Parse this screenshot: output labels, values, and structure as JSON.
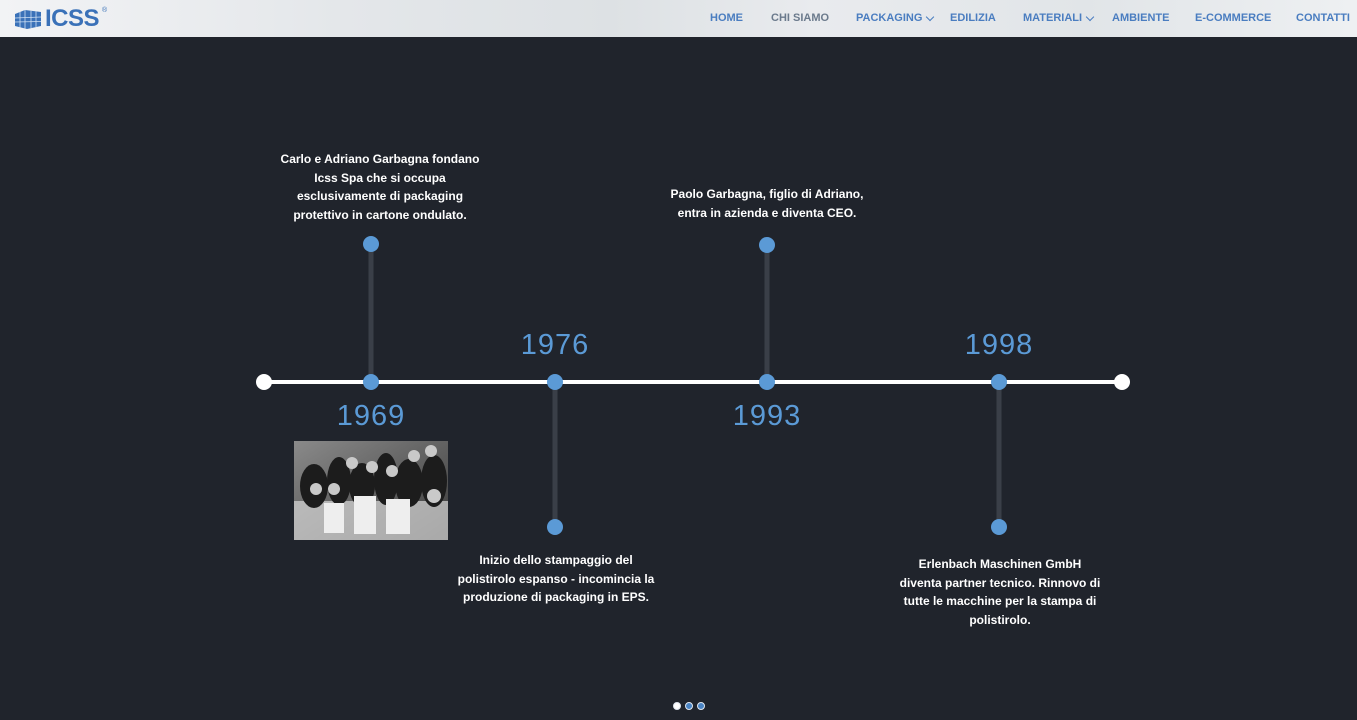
{
  "header": {
    "logo_text": "ICSS",
    "logo_reg": "®",
    "nav": [
      {
        "label": "HOME",
        "has_dropdown": false
      },
      {
        "label": "CHI SIAMO",
        "has_dropdown": false
      },
      {
        "label": "PACKAGING",
        "has_dropdown": true
      },
      {
        "label": "EDILIZIA",
        "has_dropdown": false
      },
      {
        "label": "MATERIALI",
        "has_dropdown": true
      },
      {
        "label": "AMBIENTE",
        "has_dropdown": false
      },
      {
        "label": "E-COMMERCE",
        "has_dropdown": false
      },
      {
        "label": "CONTATTI",
        "has_dropdown": false
      }
    ]
  },
  "timeline": {
    "events": [
      {
        "year": "1969",
        "text": [
          "Carlo e Adriano Garbagna fondano",
          "Icss Spa che si occupa",
          "esclusivamente di packaging",
          "protettivo in cartone ondulato."
        ]
      },
      {
        "year": "1976",
        "text": [
          "Inizio dello stampaggio del",
          "polistirolo espanso - incomincia la",
          "produzione di packaging in EPS."
        ]
      },
      {
        "year": "1993",
        "text": [
          "Paolo Garbagna, figlio di Adriano,",
          "entra in azienda e diventa CEO."
        ]
      },
      {
        "year": "1998",
        "text": [
          "Erlenbach Maschinen GmbH",
          "diventa partner tecnico. Rinnovo di",
          "tutte le macchine per la stampa di",
          "polistirolo."
        ]
      }
    ]
  },
  "colors": {
    "background": "#20242c",
    "accent": "#5b9ad6",
    "nav_text": "#4a7dc0",
    "line": "#ffffff",
    "stem": "#3a3f48"
  },
  "pagination": {
    "pages": 3,
    "active": 1
  }
}
